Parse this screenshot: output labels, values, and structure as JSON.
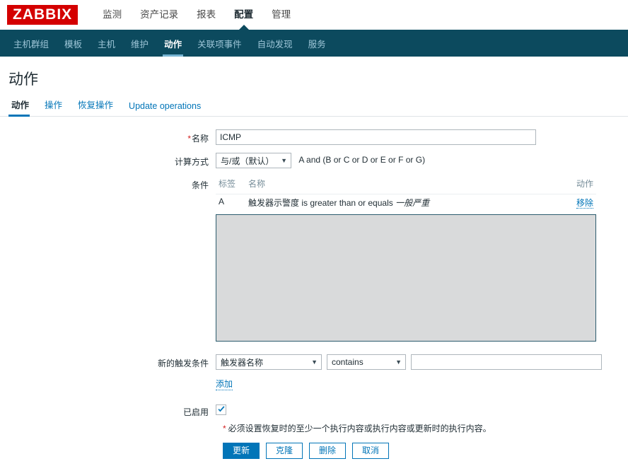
{
  "brand": {
    "logo_text": "ZABBIX",
    "logo_bg": "#d40000"
  },
  "theme": {
    "subnav_bg": "#0c4a5e",
    "accent": "#0275b8",
    "underline": "#76b3d2"
  },
  "mainnav": [
    {
      "label": "监测",
      "active": false
    },
    {
      "label": "资产记录",
      "active": false
    },
    {
      "label": "报表",
      "active": false
    },
    {
      "label": "配置",
      "active": true
    },
    {
      "label": "管理",
      "active": false
    }
  ],
  "subnav": [
    {
      "label": "主机群组",
      "active": false
    },
    {
      "label": "模板",
      "active": false
    },
    {
      "label": "主机",
      "active": false
    },
    {
      "label": "维护",
      "active": false
    },
    {
      "label": "动作",
      "active": true
    },
    {
      "label": "关联项事件",
      "active": false
    },
    {
      "label": "自动发现",
      "active": false
    },
    {
      "label": "服务",
      "active": false
    }
  ],
  "page": {
    "title": "动作"
  },
  "tabs": [
    {
      "label": "动作",
      "active": true
    },
    {
      "label": "操作",
      "active": false
    },
    {
      "label": "恢复操作",
      "active": false
    },
    {
      "label": "Update operations",
      "active": false
    }
  ],
  "form": {
    "name": {
      "label": "名称",
      "required_mark": "*",
      "value": "ICMP",
      "placeholder": ""
    },
    "calc": {
      "label": "计算方式",
      "selected": "与/或（默认）",
      "caret": "▼",
      "formula": "A and (B or C or D or E or F or G)"
    },
    "conditions": {
      "label": "条件",
      "headers": {
        "tag": "标签",
        "name": "名称",
        "action": "动作"
      },
      "rows": [
        {
          "tag": "A",
          "name_prefix": "触发器示警度 is greater than or equals ",
          "name_value": "一般严重",
          "action_label": "移除"
        }
      ]
    },
    "new_condition": {
      "label": "新的触发条件",
      "type_selected": "触发器名称",
      "operator_selected": "contains",
      "value": "",
      "value_placeholder": "",
      "caret": "▼",
      "add_label": "添加"
    },
    "enabled": {
      "label": "已启用",
      "checked": true
    },
    "footnote": {
      "mark": "*",
      "text": "必须设置恢复时的至少一个执行内容或执行内容或更新时的执行内容。"
    },
    "buttons": [
      {
        "label": "更新",
        "primary": true
      },
      {
        "label": "克隆",
        "primary": false
      },
      {
        "label": "删除",
        "primary": false
      },
      {
        "label": "取消",
        "primary": false
      }
    ]
  }
}
